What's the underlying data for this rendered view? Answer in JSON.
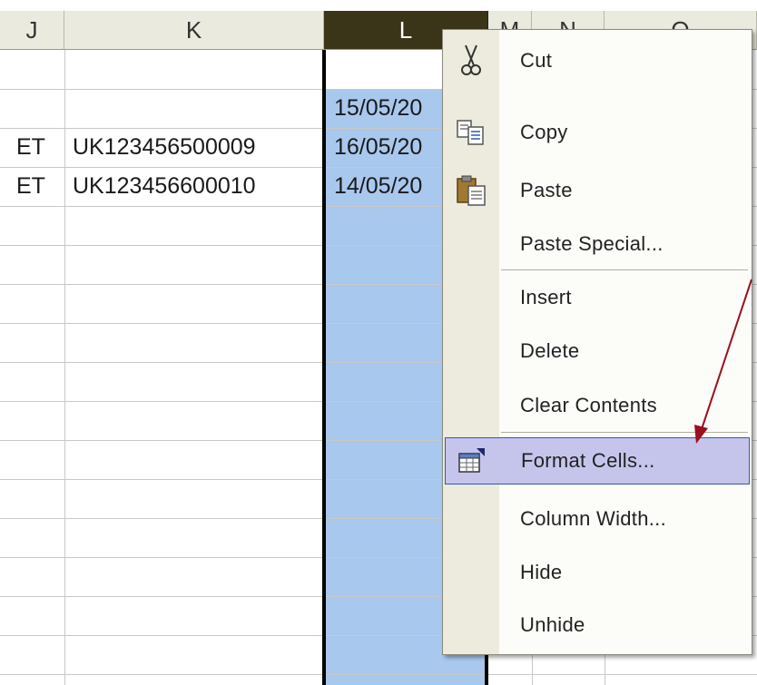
{
  "columns": {
    "headers": [
      "J",
      "K",
      "L",
      "M",
      "N",
      "O"
    ],
    "selected": "L"
  },
  "rows": [
    {
      "j": "",
      "k": "",
      "l": ""
    },
    {
      "j": "",
      "k": "",
      "l": "15/05/20"
    },
    {
      "j": "ET",
      "k": "UK123456500009",
      "l": "16/05/20"
    },
    {
      "j": "ET",
      "k": "UK123456600010",
      "l": "14/05/20"
    }
  ],
  "context_menu": {
    "items": [
      {
        "label": "Cut",
        "icon": "scissors-icon"
      },
      {
        "label": "Copy",
        "icon": "copy-icon"
      },
      {
        "label": "Paste",
        "icon": "paste-icon"
      },
      {
        "label": "Paste Special...",
        "icon": ""
      },
      {
        "label": "Insert",
        "icon": ""
      },
      {
        "label": "Delete",
        "icon": ""
      },
      {
        "label": "Clear Contents",
        "icon": ""
      },
      {
        "label": "Format Cells...",
        "icon": "format-cells-icon",
        "highlighted": true
      },
      {
        "label": "Column Width...",
        "icon": ""
      },
      {
        "label": "Hide",
        "icon": ""
      },
      {
        "label": "Unhide",
        "icon": ""
      }
    ]
  },
  "colors": {
    "selection_fill": "#a9c8ee",
    "selected_header": "#3a3418",
    "menu_highlight": "#c5c5ec",
    "annotation_arrow": "#9b1020"
  }
}
